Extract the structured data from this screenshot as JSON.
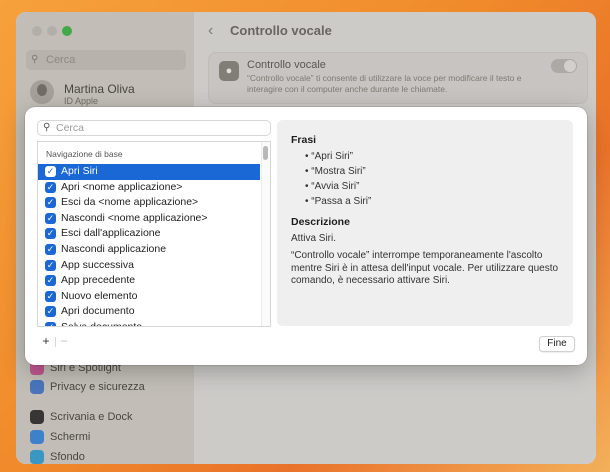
{
  "background": {
    "sidebar": {
      "search_placeholder": "Cerca",
      "user": {
        "name": "Martina Oliva",
        "subtitle": "ID Apple"
      },
      "items": [
        {
          "label": "Siri e Spotlight",
          "color": "#d95aa0"
        },
        {
          "label": "Privacy e sicurezza",
          "color": "#4a7fd8"
        },
        {
          "label": "Scrivania e Dock",
          "color": "#333333"
        },
        {
          "label": "Schermi",
          "color": "#3b8de8"
        },
        {
          "label": "Sfondo",
          "color": "#36a9e0"
        }
      ]
    },
    "header": {
      "title": "Controllo vocale"
    },
    "card": {
      "title": "Controllo vocale",
      "description": "“Controllo vocale” ti consente di utilizzare la voce per modificare il testo e interagire con il computer anche durante le chiamate.",
      "toggle_on": false
    }
  },
  "sheet": {
    "search": {
      "placeholder": "Cerca",
      "value": ""
    },
    "list": {
      "section_header": "Navigazione di base",
      "items": [
        {
          "label": "Apri Siri",
          "checked": true,
          "selected": true
        },
        {
          "label": "Apri <nome applicazione>",
          "checked": true,
          "selected": false
        },
        {
          "label": "Esci da <nome applicazione>",
          "checked": true,
          "selected": false
        },
        {
          "label": "Nascondi <nome applicazione>",
          "checked": true,
          "selected": false
        },
        {
          "label": "Esci dall'applicazione",
          "checked": true,
          "selected": false
        },
        {
          "label": "Nascondi applicazione",
          "checked": true,
          "selected": false
        },
        {
          "label": "App successiva",
          "checked": true,
          "selected": false
        },
        {
          "label": "App precedente",
          "checked": true,
          "selected": false
        },
        {
          "label": "Nuovo elemento",
          "checked": true,
          "selected": false
        },
        {
          "label": "Apri documento",
          "checked": true,
          "selected": false
        },
        {
          "label": "Salva documento",
          "checked": true,
          "selected": false
        }
      ]
    },
    "add_label": "+",
    "remove_label": "−",
    "detail": {
      "phrases_title": "Frasi",
      "phrases": [
        "“Apri Siri”",
        "“Mostra Siri”",
        "“Avvia Siri”",
        "“Passa a Siri”"
      ],
      "description_title": "Descrizione",
      "description_short": "Attiva Siri.",
      "description_long": "“Controllo vocale” interrompe temporaneamente l'ascolto mentre Siri è in attesa dell'input vocale. Per utilizzare questo comando, è necessario attivare Siri."
    },
    "done_label": "Fine"
  },
  "colors": {
    "accent": "#1a67d6",
    "toggle_active": "#3fbf4a"
  }
}
